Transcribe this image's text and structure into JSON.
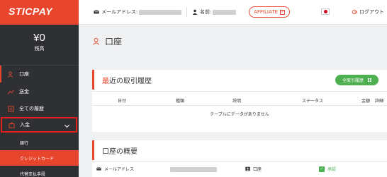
{
  "brand": {
    "logo_text": "STICPAY"
  },
  "header": {
    "email_label": "メールアドレス:",
    "name_label": "名前:",
    "affiliate_label": "AFFILIATE",
    "logout_label": "ログアウト"
  },
  "sidebar": {
    "balance_amount": "¥0",
    "balance_label": "残高",
    "items": [
      {
        "label": "口座",
        "icon": "user-icon"
      },
      {
        "label": "送金",
        "icon": "transfer-icon"
      },
      {
        "label": "全ての履歴",
        "icon": "history-icon"
      },
      {
        "label": "入金",
        "icon": "deposit-icon"
      }
    ],
    "sub_items": [
      {
        "label": "銀行"
      },
      {
        "label": "クレジットカード"
      },
      {
        "label": "代替支払手段"
      }
    ]
  },
  "main": {
    "page_title": "口座",
    "history": {
      "title_accent": "最",
      "title_rest": "近の取引履歴",
      "all_button": "全取引履歴",
      "columns": [
        "日付",
        "種類",
        "説明",
        "ステータス",
        "金額",
        "詳細"
      ],
      "empty_message": "テーブルにデータがありません"
    },
    "overview": {
      "title": "口座の概要",
      "email_label": "メールアドレス",
      "account_label": "口座",
      "status_label": "承認",
      "status_check": "✓"
    }
  },
  "colors": {
    "accent": "#e8462c",
    "sidebar_bg": "#2f3033",
    "success": "#4caf50"
  }
}
